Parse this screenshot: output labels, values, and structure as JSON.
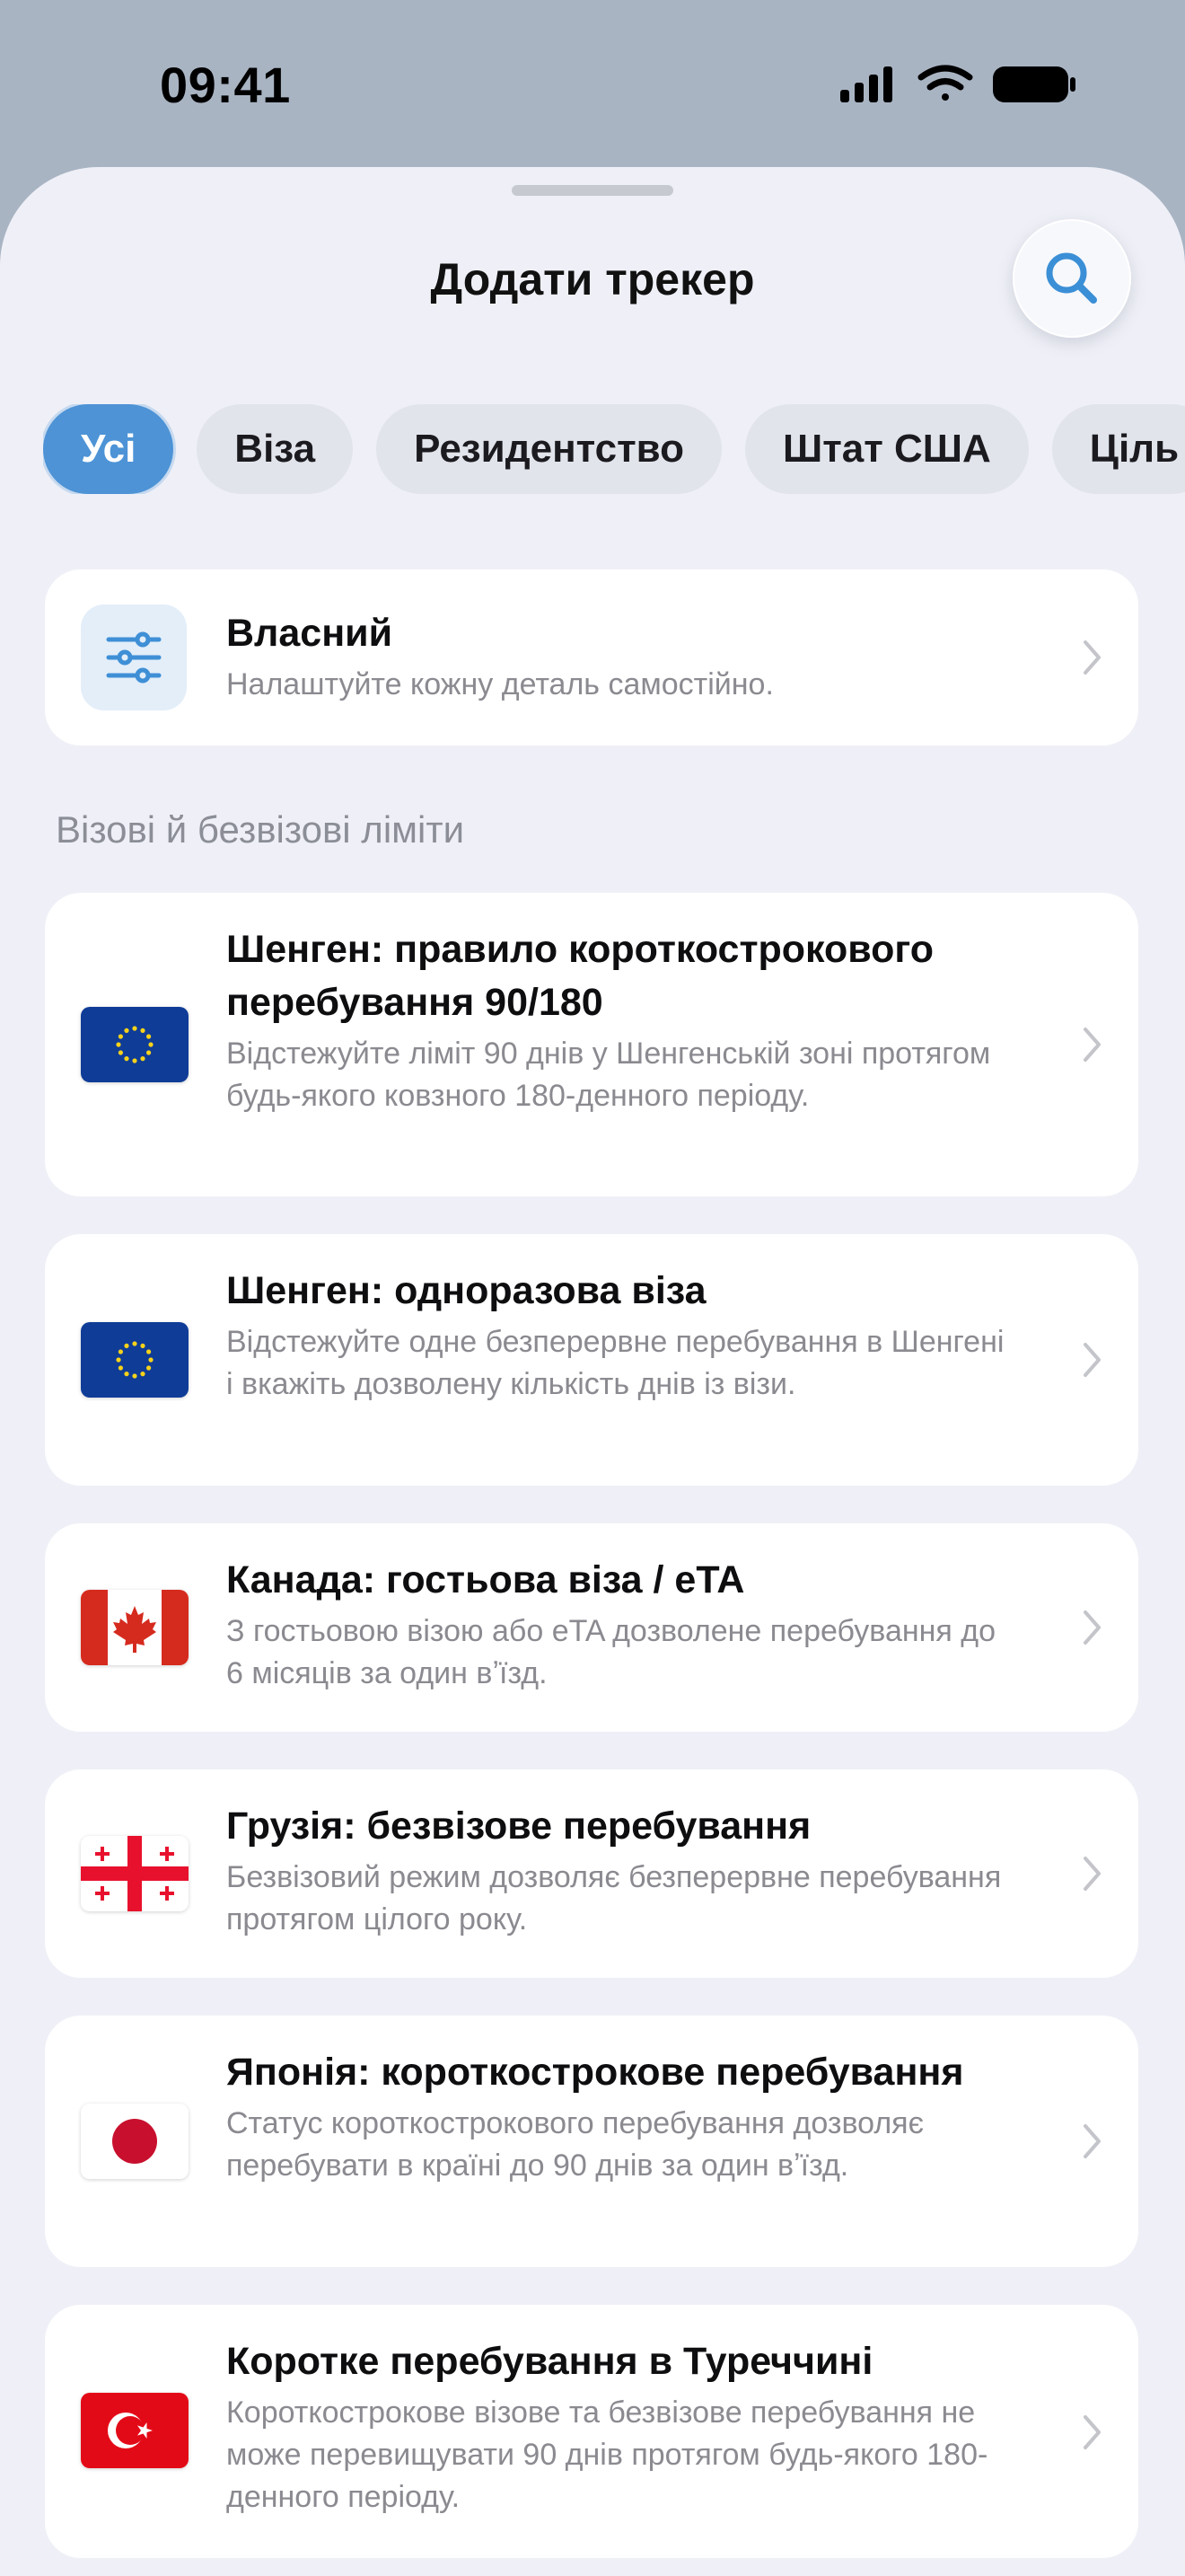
{
  "status_bar": {
    "time": "09:41"
  },
  "sheet": {
    "title": "Додати трекер"
  },
  "filters": [
    {
      "label": "Усі",
      "active": true
    },
    {
      "label": "Віза",
      "active": false
    },
    {
      "label": "Резидентство",
      "active": false
    },
    {
      "label": "Штат США",
      "active": false
    },
    {
      "label": "Ціль",
      "active": false
    }
  ],
  "custom": {
    "title": "Власний",
    "description": "Налаштуйте кожну деталь самостійно.",
    "icon": "sliders-icon"
  },
  "section": {
    "title": "Візові й безвізові ліміти"
  },
  "trackers": [
    {
      "flag": "eu-flag-icon",
      "title": "Шенген: правило короткострокового перебування 90/180",
      "description": "Відстежуйте ліміт 90 днів у Шенгенській зоні протягом будь-якого ковзного 180-денного періоду."
    },
    {
      "flag": "eu-flag-icon",
      "title": "Шенген: одноразова віза",
      "description": "Відстежуйте одне безперервне перебування в Шенгені і вкажіть дозволену кількість днів із візи."
    },
    {
      "flag": "canada-flag-icon",
      "title": "Канада: гостьова віза / eTA",
      "description": "З гостьовою візою або eTA дозволене перебування до 6 місяців за один вʼїзд."
    },
    {
      "flag": "georgia-flag-icon",
      "title": "Грузія: безвізове перебування",
      "description": "Безвізовий режим дозволяє безперервне перебування протягом цілого року."
    },
    {
      "flag": "japan-flag-icon",
      "title": "Японія: короткострокове перебування",
      "description": "Статус короткострокового перебування дозволяє перебувати в країні до 90 днів за один вʼїзд."
    },
    {
      "flag": "turkey-flag-icon",
      "title": "Коротке перебування в Туреччині",
      "description": "Короткострокове візове та безвізове перебування не може перевищувати 90 днів протягом будь-якого 180-денного періоду."
    }
  ],
  "colors": {
    "accent": "#4d93d6",
    "sheet_bg": "#eff0f7",
    "backdrop": "#a9b4c3"
  }
}
